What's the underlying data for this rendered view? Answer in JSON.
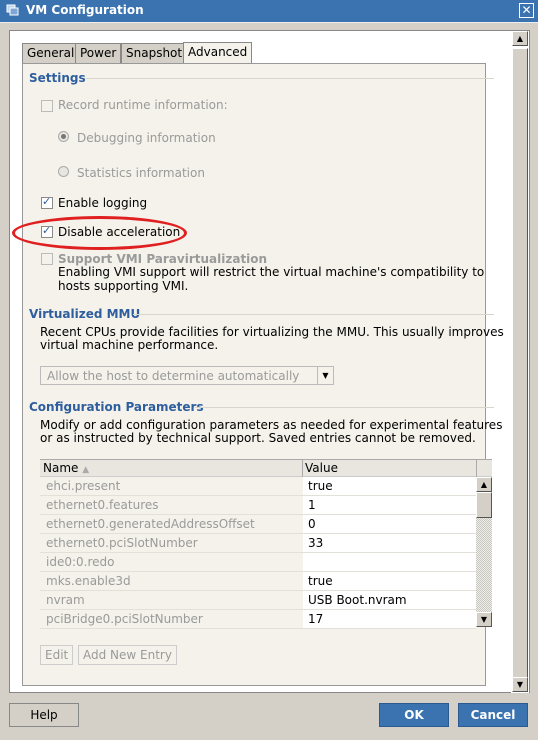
{
  "window": {
    "title": "VM Configuration",
    "close_label": "✕"
  },
  "tabs": [
    {
      "label": "General",
      "active": false
    },
    {
      "label": "Power",
      "active": false
    },
    {
      "label": "Snapshot",
      "active": false
    },
    {
      "label": "Advanced",
      "active": true
    }
  ],
  "settings": {
    "heading": "Settings",
    "record_runtime": {
      "label": "Record runtime information:",
      "checked": false,
      "disabled": true
    },
    "debugging": {
      "label": "Debugging information",
      "selected": true,
      "disabled": true
    },
    "statistics": {
      "label": "Statistics information",
      "selected": false,
      "disabled": true
    },
    "enable_logging": {
      "label": "Enable logging",
      "checked": true
    },
    "disable_acceleration": {
      "label": "Disable acceleration",
      "checked": true
    },
    "vmi": {
      "label": "Support VMI Paravirtualization",
      "checked": false,
      "disabled": true,
      "description_line1": "Enabling VMI support will restrict the virtual machine's compatibility to",
      "description_line2": "hosts supporting VMI."
    }
  },
  "mmu": {
    "heading": "Virtualized MMU",
    "description_line1": "Recent CPUs provide facilities for virtualizing the MMU. This usually improves",
    "description_line2": "virtual machine performance.",
    "select_value": "Allow the host to determine automatically"
  },
  "config_params": {
    "heading": "Configuration Parameters",
    "description_line1": "Modify or add configuration parameters as needed for experimental features",
    "description_line2": "or as instructed by technical support. Saved entries cannot be removed.",
    "columns": {
      "name": "Name",
      "value": "Value",
      "sort_indicator": "▲"
    },
    "rows": [
      {
        "name": "ehci.present",
        "value": "true"
      },
      {
        "name": "ethernet0.features",
        "value": "1"
      },
      {
        "name": "ethernet0.generatedAddressOffset",
        "value": "0"
      },
      {
        "name": "ethernet0.pciSlotNumber",
        "value": "33"
      },
      {
        "name": "ide0:0.redo",
        "value": ""
      },
      {
        "name": "mks.enable3d",
        "value": "true"
      },
      {
        "name": "nvram",
        "value": "USB Boot.nvram"
      },
      {
        "name": "pciBridge0.pciSlotNumber",
        "value": "17"
      }
    ],
    "edit_label": "Edit",
    "add_label": "Add New Entry"
  },
  "footer": {
    "help_label": "Help",
    "ok_label": "OK",
    "cancel_label": "Cancel"
  },
  "colors": {
    "title_bar": "#3a73b0",
    "section_heading": "#2e5e9e",
    "annotation": "#e02020"
  }
}
